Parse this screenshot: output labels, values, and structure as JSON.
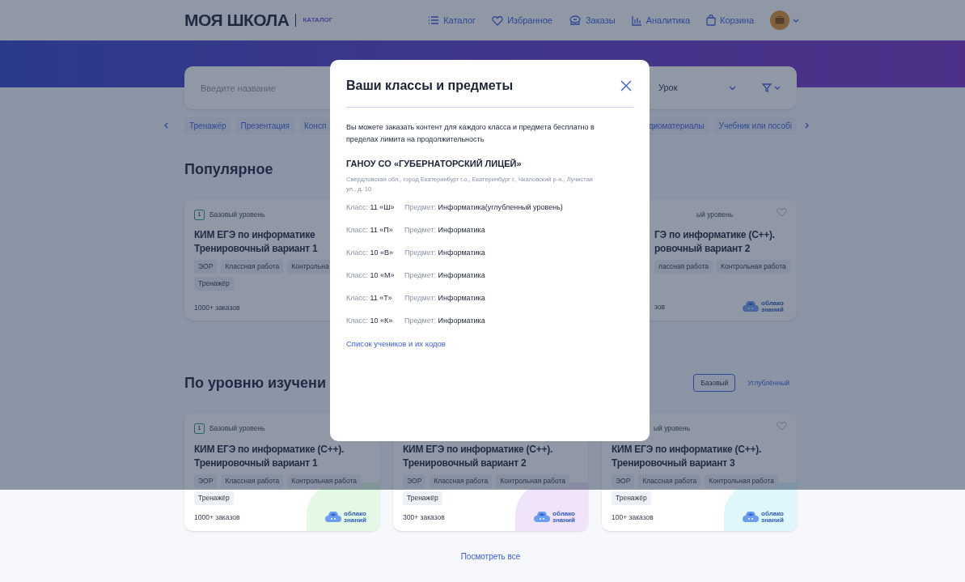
{
  "header": {
    "logo": "МОЯ ШКОЛА",
    "logo_sub": "КАТАЛОГ",
    "nav": [
      "Каталог",
      "Избранное",
      "Заказы",
      "Аналитика",
      "Корзина"
    ]
  },
  "search": {
    "placeholder": "Введите название",
    "type_value": "Урок"
  },
  "chips_left": [
    "Тренажёр",
    "Презентация",
    "Консп"
  ],
  "chips_right": [
    "диоматериалы",
    "Учебник или пособі"
  ],
  "popular": {
    "title": "Популярное",
    "cards": [
      {
        "badge": "1",
        "level": "Базовый уровень",
        "title": [
          "КИМ ЕГЭ по информатике",
          "Тренировочный вариант 1"
        ],
        "tag_rows": [
          [
            "ЭОР",
            "Классная работа",
            "Контрольна"
          ],
          [
            "Тренажёр"
          ]
        ],
        "orders": "1000+ заказов"
      },
      {
        "level": "ый уровень",
        "title": [
          "ГЭ по информатике (С++).",
          "ровочный вариант 2"
        ],
        "tag_rows": [
          [
            "лассная работа",
            "Контрольная работа"
          ]
        ],
        "orders": "зов",
        "brand": "облако знаний",
        "favorite": false
      }
    ]
  },
  "by_level": {
    "title": "По уровню изучени",
    "filters": [
      {
        "label": "Базовый",
        "selected": true
      },
      {
        "label": "Углублённый",
        "selected": false
      }
    ],
    "cards": [
      {
        "badge": "1",
        "level": "Базовый уровень",
        "title": [
          "КИМ ЕГЭ по информатике (С++).",
          "Тренировочный вариант 1"
        ],
        "tag_rows": [
          [
            "ЭОР",
            "Классная работа",
            "Контрольная работа"
          ],
          [
            "Тренажёр"
          ]
        ],
        "orders": "1000+ заказов",
        "brand": "облако знаний",
        "color": "#e3f9e3"
      },
      {
        "title": [
          "КИМ ЕГЭ по информатике (С++).",
          "Тренировочный вариант 2"
        ],
        "tag_rows": [
          [
            "ЭОР",
            "Классная работа",
            "Контрольная работа"
          ],
          [
            "Тренажёр"
          ]
        ],
        "orders": "300+ заказов",
        "brand": "облако знаний",
        "color": "#f1e3fa"
      },
      {
        "level": "ый уровень",
        "title": [
          "КИМ ЕГЭ по информатике (С++).",
          "Тренировочный вариант 3"
        ],
        "tag_rows": [
          [
            "ЭОР",
            "Классная работа",
            "Контрольная работа"
          ],
          [
            "Тренажёр"
          ]
        ],
        "orders": "100+ заказов",
        "brand": "облако знаний",
        "favorite": false,
        "color": "#ddf7fb"
      }
    ],
    "more": "Посмотреть все"
  },
  "modal": {
    "title": "Ваши классы и предметы",
    "intro": "Вы можете заказать контент для каждого класса и предмета бесплатно в пределах лимита на продолжительность",
    "school": "ГАНОУ СО «ГУБЕРНАТОРСКИЙ ЛИЦЕЙ»",
    "address": "Свердловская обл., город Екатеринбург г.о., Екатеринбург г., Чкаловский р-н., Лучистая ул., д. 10",
    "classes": [
      {
        "class_label": "Класс:",
        "class_value": "11 «Ш»",
        "subject_label": "Предмет:",
        "subject_value": "Информатика(углубленный уровень)"
      },
      {
        "class_label": "Класс:",
        "class_value": "11 «П»",
        "subject_label": "Предмет:",
        "subject_value": "Информатика"
      },
      {
        "class_label": "Класс:",
        "class_value": "10 «В»",
        "subject_label": "Предмет:",
        "subject_value": "Информатика"
      },
      {
        "class_label": "Класс:",
        "class_value": "10 «М»",
        "subject_label": "Предмет:",
        "subject_value": "Информатика"
      },
      {
        "class_label": "Класс:",
        "class_value": "11 «Т»",
        "subject_label": "Предмет:",
        "subject_value": "Информатика"
      },
      {
        "class_label": "Класс:",
        "class_value": "10 «К»",
        "subject_label": "Предмет:",
        "subject_value": "Информатика"
      }
    ],
    "link": "Список учеников и их кодов"
  }
}
